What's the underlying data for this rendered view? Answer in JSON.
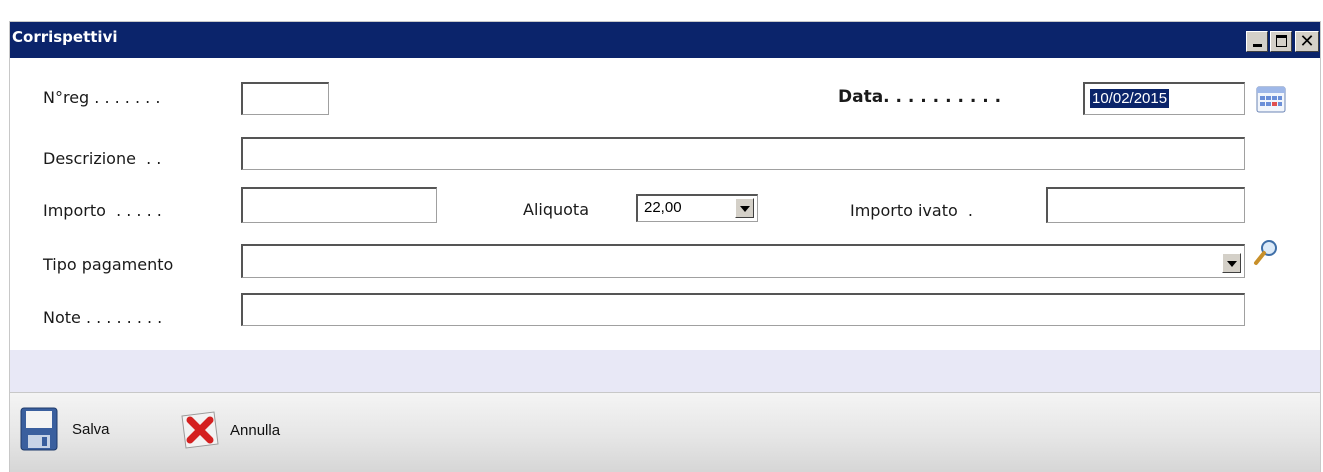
{
  "window": {
    "title": "Corrispettivi",
    "controls": [
      "minimize",
      "maximize",
      "close"
    ],
    "close_glyph": "✕"
  },
  "form": {
    "nreg_label": "N°reg . . . . . . .",
    "nreg_value": "",
    "data_label": "Data. . . . . . . . . .",
    "data_value": "10/02/2015",
    "descrizione_label": "Descrizione  . .",
    "descrizione_value": "",
    "importo_label": "Importo  . . . . .",
    "importo_value": "",
    "aliquota_label": "Aliquota",
    "aliquota_value": "22,00",
    "importo_ivato_label": "Importo ivato  .",
    "importo_ivato_value": "",
    "tipo_pagamento_label": "Tipo pagamento",
    "tipo_pagamento_value": "",
    "note_label": "Note . . . . . . . .",
    "note_value": ""
  },
  "icons": {
    "calendar": "calendar-icon",
    "search": "magnifier-icon",
    "save": "floppy-disk-icon",
    "cancel": "red-x-icon"
  },
  "toolbar": {
    "save_label": "Salva",
    "cancel_label": "Annulla"
  },
  "colors": {
    "titlebar": "#0b246b",
    "selection": "#0a246a",
    "band": "#e8e8f6"
  }
}
